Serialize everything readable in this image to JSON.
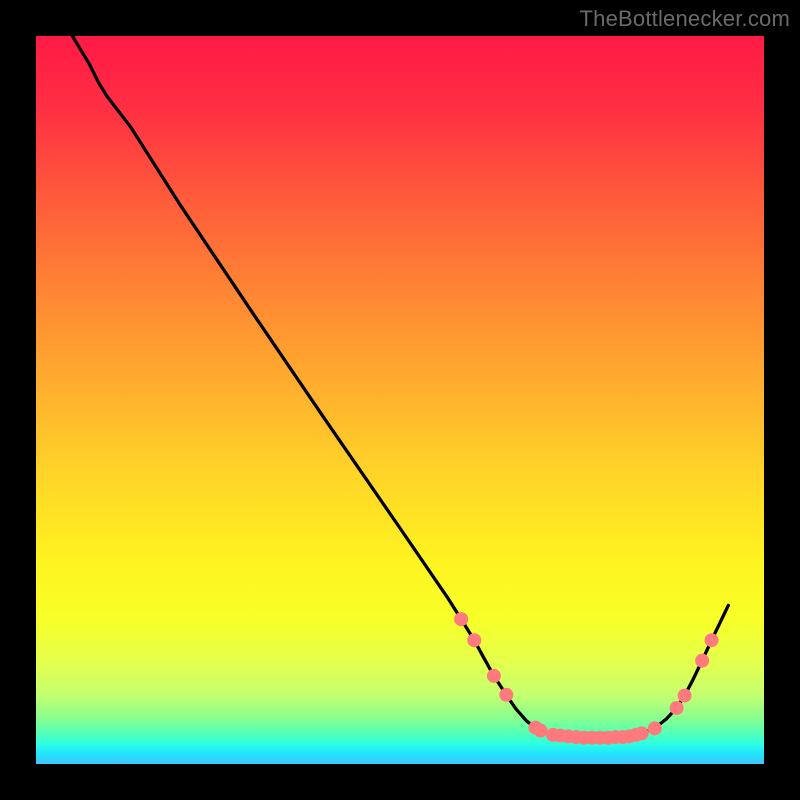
{
  "watermark": "TheBottlenecker.com",
  "gradient_stops": [
    {
      "offset": 0.0,
      "color": "#ff1a45"
    },
    {
      "offset": 0.1,
      "color": "#ff2f43"
    },
    {
      "offset": 0.22,
      "color": "#ff5a3b"
    },
    {
      "offset": 0.35,
      "color": "#ff8534"
    },
    {
      "offset": 0.48,
      "color": "#ffae2e"
    },
    {
      "offset": 0.6,
      "color": "#ffd428"
    },
    {
      "offset": 0.72,
      "color": "#fff320"
    },
    {
      "offset": 0.8,
      "color": "#f8ff28"
    },
    {
      "offset": 0.86,
      "color": "#e4ff4c"
    },
    {
      "offset": 0.905,
      "color": "#c4ff70"
    },
    {
      "offset": 0.935,
      "color": "#8dff8d"
    },
    {
      "offset": 0.955,
      "color": "#5affb0"
    },
    {
      "offset": 0.972,
      "color": "#2effe0"
    },
    {
      "offset": 0.985,
      "color": "#20e6ff"
    },
    {
      "offset": 1.0,
      "color": "#40c4ff"
    }
  ],
  "marker_color": "#ff7a7d",
  "marker_radius": 7,
  "chart_data": {
    "type": "line",
    "title": "",
    "xlabel": "",
    "ylabel": "",
    "xlim": [
      0,
      100
    ],
    "ylim": [
      0,
      100
    ],
    "series": [
      {
        "name": "curve",
        "color": "#000000",
        "points": [
          {
            "x": 5.0,
            "y": 100.0
          },
          {
            "x": 7.3,
            "y": 96.2
          },
          {
            "x": 8.6,
            "y": 93.6
          },
          {
            "x": 9.7,
            "y": 91.8
          },
          {
            "x": 13.0,
            "y": 87.5
          },
          {
            "x": 20.0,
            "y": 76.5
          },
          {
            "x": 30.0,
            "y": 61.6
          },
          {
            "x": 40.0,
            "y": 46.9
          },
          {
            "x": 50.0,
            "y": 32.4
          },
          {
            "x": 56.5,
            "y": 22.9
          },
          {
            "x": 58.4,
            "y": 19.9
          },
          {
            "x": 60.2,
            "y": 17.0
          },
          {
            "x": 61.5,
            "y": 14.6
          },
          {
            "x": 62.9,
            "y": 12.1
          },
          {
            "x": 64.6,
            "y": 9.5
          },
          {
            "x": 65.9,
            "y": 7.6
          },
          {
            "x": 67.4,
            "y": 5.9
          },
          {
            "x": 68.6,
            "y": 5.0
          },
          {
            "x": 70.5,
            "y": 4.2
          },
          {
            "x": 72.8,
            "y": 3.8
          },
          {
            "x": 75.4,
            "y": 3.6
          },
          {
            "x": 78.2,
            "y": 3.6
          },
          {
            "x": 81.0,
            "y": 3.8
          },
          {
            "x": 83.3,
            "y": 4.2
          },
          {
            "x": 85.2,
            "y": 5.1
          },
          {
            "x": 86.6,
            "y": 6.2
          },
          {
            "x": 88.0,
            "y": 7.7
          },
          {
            "x": 89.1,
            "y": 9.4
          },
          {
            "x": 90.3,
            "y": 11.7
          },
          {
            "x": 91.5,
            "y": 14.2
          },
          {
            "x": 92.8,
            "y": 17.0
          },
          {
            "x": 94.1,
            "y": 19.7
          },
          {
            "x": 95.1,
            "y": 21.8
          }
        ]
      }
    ],
    "markers": [
      {
        "x": 58.4,
        "y": 19.9
      },
      {
        "x": 60.2,
        "y": 17.0
      },
      {
        "x": 62.9,
        "y": 12.1
      },
      {
        "x": 64.6,
        "y": 9.5
      },
      {
        "x": 68.6,
        "y": 5.0
      },
      {
        "x": 69.3,
        "y": 4.6
      },
      {
        "x": 71.0,
        "y": 4.0
      },
      {
        "x": 72.0,
        "y": 3.9
      },
      {
        "x": 73.1,
        "y": 3.8
      },
      {
        "x": 74.2,
        "y": 3.7
      },
      {
        "x": 75.3,
        "y": 3.6
      },
      {
        "x": 76.4,
        "y": 3.6
      },
      {
        "x": 77.5,
        "y": 3.6
      },
      {
        "x": 78.6,
        "y": 3.6
      },
      {
        "x": 79.6,
        "y": 3.7
      },
      {
        "x": 80.6,
        "y": 3.7
      },
      {
        "x": 81.5,
        "y": 3.8
      },
      {
        "x": 82.4,
        "y": 4.0
      },
      {
        "x": 83.2,
        "y": 4.2
      },
      {
        "x": 85.0,
        "y": 4.9
      },
      {
        "x": 88.0,
        "y": 7.7
      },
      {
        "x": 89.1,
        "y": 9.4
      },
      {
        "x": 91.5,
        "y": 14.2
      },
      {
        "x": 92.8,
        "y": 17.0
      }
    ]
  }
}
